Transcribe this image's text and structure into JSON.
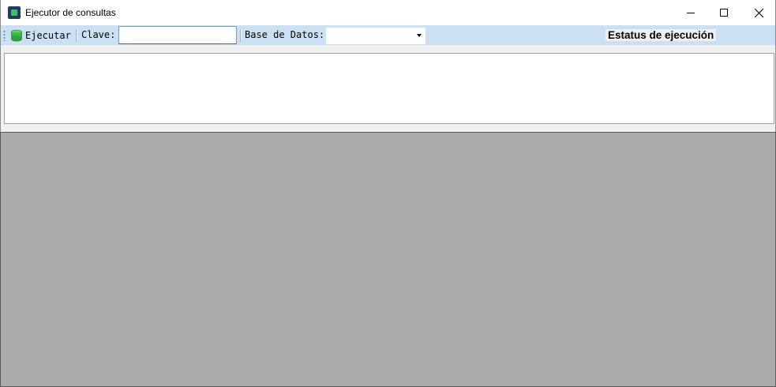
{
  "window": {
    "title": "Ejecutor de consultas",
    "icon": "database-query-icon",
    "controls": [
      "minimize-icon",
      "maximize-icon",
      "close-icon"
    ]
  },
  "toolbar": {
    "execute_label": "Ejecutar",
    "execute_icon": "database-icon",
    "clave_label": "Clave:",
    "clave_value": "",
    "database_label": "Base de Datos:",
    "database_value": "",
    "status_label": "Estatus de ejecución"
  },
  "query": {
    "text": ""
  },
  "colors": {
    "toolbar_bg": "#cce0f4",
    "panel_bg": "#f0f0f0",
    "results_bg": "#ababab",
    "input_focus_border": "#2a6fb8"
  }
}
